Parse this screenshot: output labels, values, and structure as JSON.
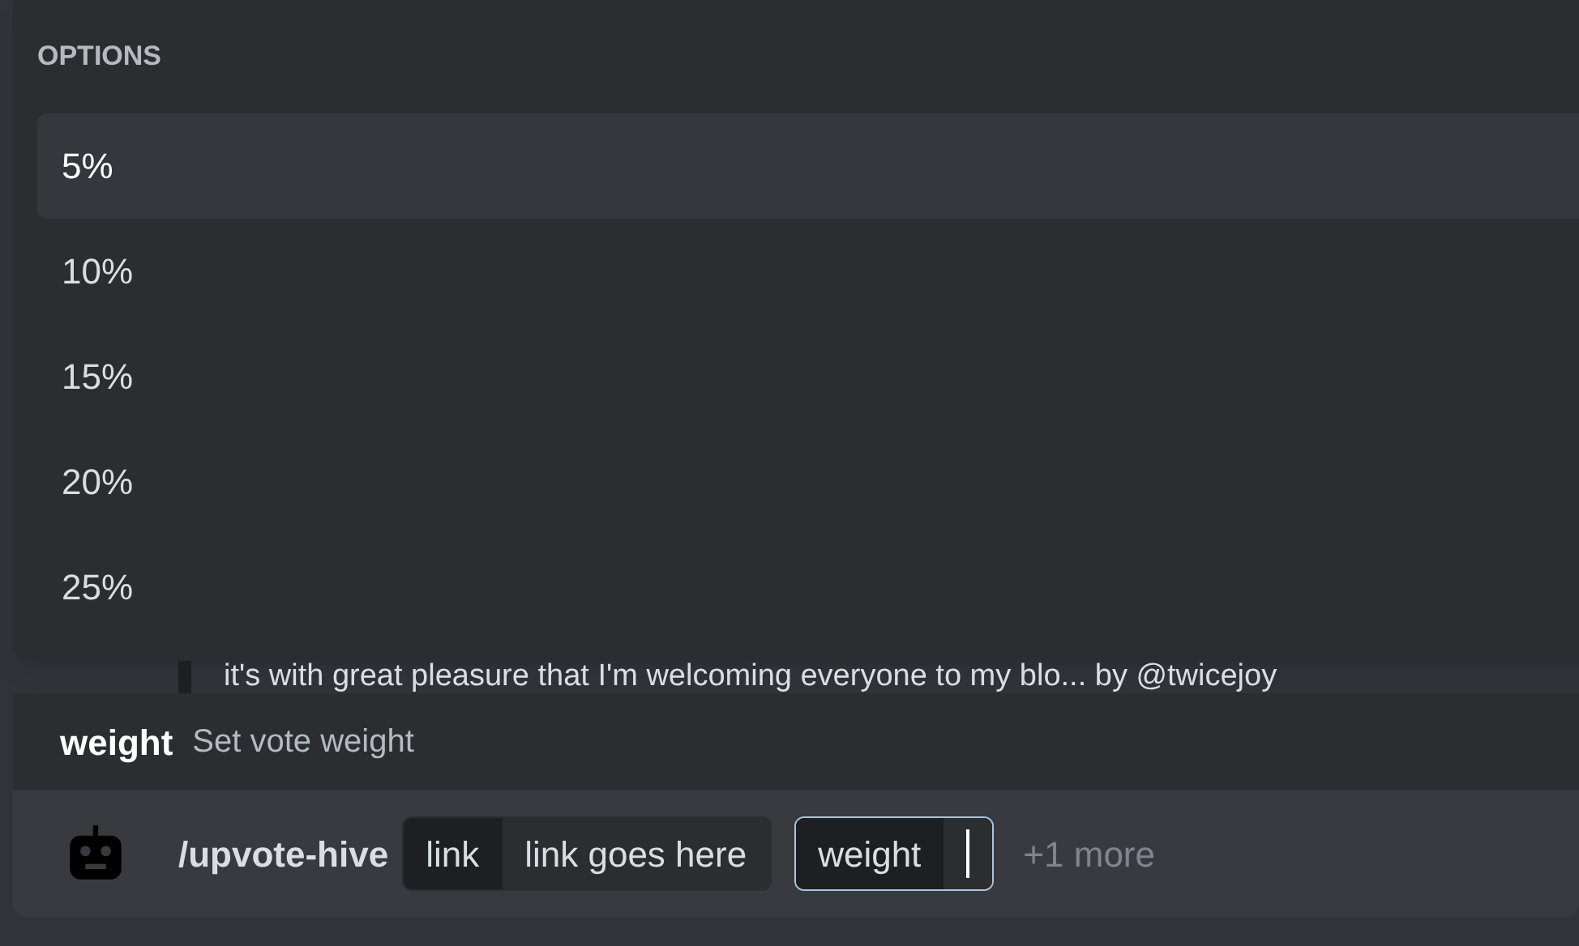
{
  "options_popup": {
    "header": "OPTIONS",
    "items": [
      {
        "label": "5%",
        "selected": true
      },
      {
        "label": "10%",
        "selected": false
      },
      {
        "label": "15%",
        "selected": false
      },
      {
        "label": "20%",
        "selected": false
      },
      {
        "label": "25%",
        "selected": false
      }
    ]
  },
  "message_preview": "it's with great pleasure that I'm welcoming everyone to my blo... by @twicejoy",
  "option_hint": {
    "name": "weight",
    "description": "Set vote weight"
  },
  "command_bar": {
    "command": "/upvote-hive",
    "params": [
      {
        "name": "link",
        "value": "link goes here",
        "focused": false
      },
      {
        "name": "weight",
        "focused": true
      }
    ],
    "more": "+1 more"
  }
}
